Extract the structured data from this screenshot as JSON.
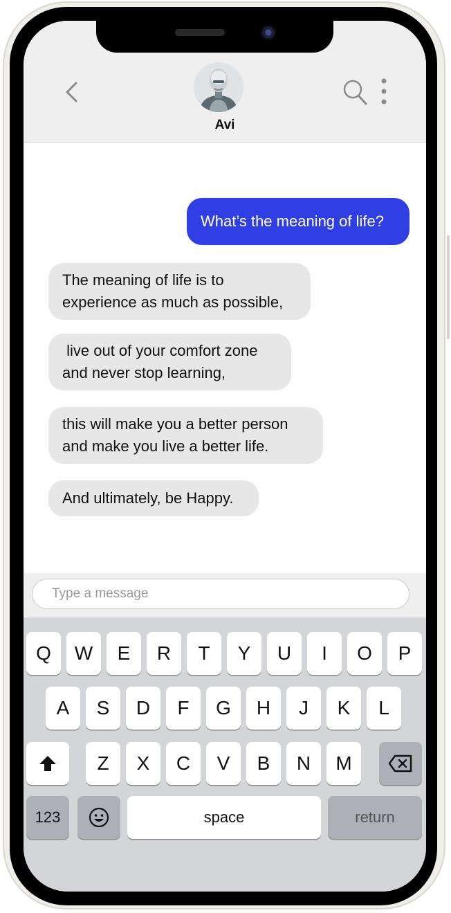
{
  "header": {
    "back_icon": "chevron-left-icon",
    "contact_name": "Avi",
    "avatar_icon": "robot-avatar",
    "search_icon": "search-icon",
    "more_icon": "more-vertical-icon"
  },
  "messages": [
    {
      "direction": "outgoing",
      "text": "What’s the meaning of life?"
    },
    {
      "direction": "incoming",
      "text": "The meaning of life is to\nexperience as much as possible,"
    },
    {
      "direction": "incoming",
      "text": " live out of your comfort zone\nand never stop learning,"
    },
    {
      "direction": "incoming",
      "text": "this will make you a better person\nand make you live a better life."
    },
    {
      "direction": "incoming",
      "text": "And ultimately, be Happy."
    }
  ],
  "composer": {
    "placeholder": "Type a message"
  },
  "keyboard": {
    "row1": [
      "Q",
      "W",
      "E",
      "R",
      "T",
      "Y",
      "U",
      "I",
      "O",
      "P"
    ],
    "row2": [
      "A",
      "S",
      "D",
      "F",
      "G",
      "H",
      "J",
      "K",
      "L"
    ],
    "row3": [
      "Z",
      "X",
      "C",
      "V",
      "B",
      "N",
      "M"
    ],
    "shift_icon": "shift-arrow-icon",
    "backspace_icon": "backspace-icon",
    "numbers_label": "123",
    "emoji_icon": "emoji-icon",
    "space_label": "space",
    "return_label": "return"
  },
  "colors": {
    "outgoing_bubble": "#2f3fe3",
    "incoming_bubble": "#e7e7e7",
    "header_bg": "#efefef",
    "keyboard_bg": "#d4d5d9"
  }
}
